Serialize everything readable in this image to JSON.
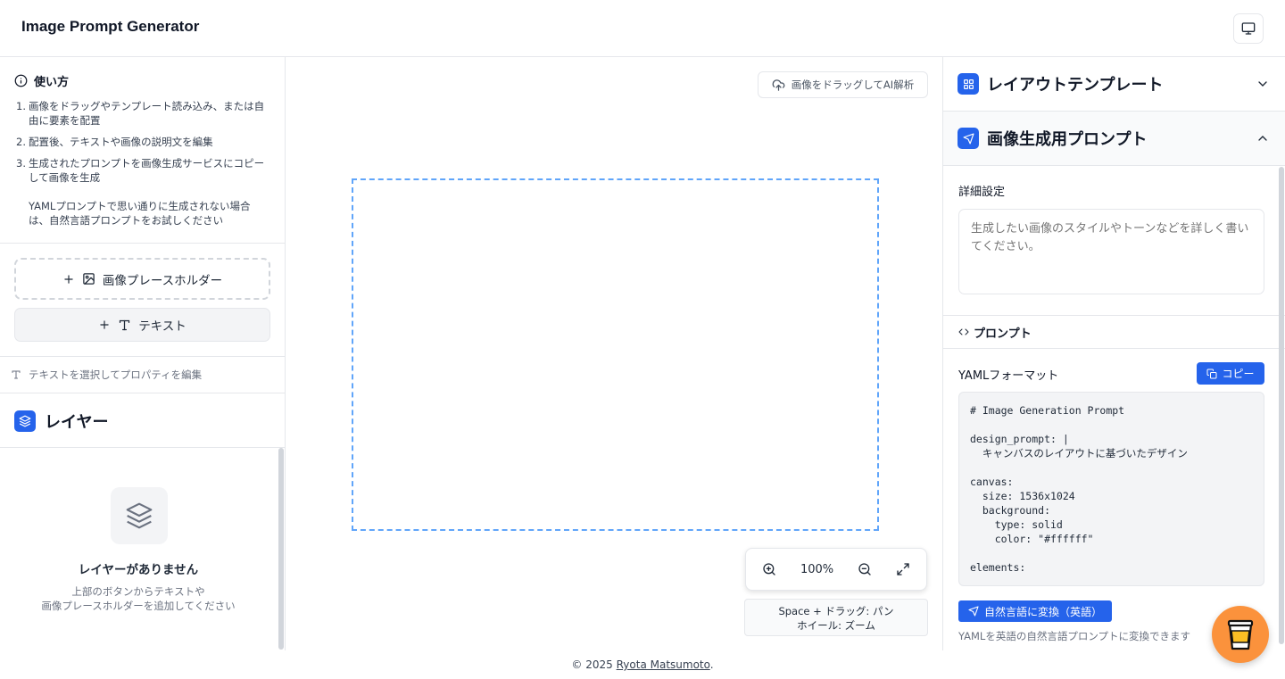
{
  "header": {
    "title": "Image Prompt Generator",
    "monitor_icon": "monitor-icon"
  },
  "howto": {
    "title": "使い方",
    "steps": [
      {
        "num": "1.",
        "text": "画像をドラッグやテンプレート読み込み、または自由に要素を配置"
      },
      {
        "num": "2.",
        "text": "配置後、テキストや画像の説明文を編集"
      },
      {
        "num": "3.",
        "text": "生成されたプロンプトを画像生成サービスにコピーして画像を生成"
      }
    ],
    "note": "YAMLプロンプトで思い通りに生成されない場合は、自然言語プロンプトをお試しください"
  },
  "tools": {
    "image_placeholder_label": "画像プレースホルダー",
    "text_label": "テキスト",
    "property_hint": "テキストを選択してプロパティを編集"
  },
  "layers": {
    "title": "レイヤー",
    "empty_title": "レイヤーがありません",
    "empty_desc_1": "上部のボタンからテキストや",
    "empty_desc_2": "画像プレースホルダーを追加してください"
  },
  "canvas": {
    "ai_button_label": "画像をドラッグしてAI解析",
    "zoom_level": "100%",
    "help_line_1": "Space + ドラッグ: パン",
    "help_line_2": "ホイール: ズーム"
  },
  "right": {
    "layout_template_title": "レイアウトテンプレート",
    "prompt_section_title": "画像生成用プロンプト",
    "detail_label": "詳細設定",
    "detail_placeholder": "生成したい画像のスタイルやトーンなどを詳しく書いてください。",
    "prompt_tab": "プロンプト",
    "yaml_label": "YAMLフォーマット",
    "copy_label": "コピー",
    "yaml_code": "# Image Generation Prompt\n\ndesign_prompt: |\n  キャンバスのレイアウトに基づいたデザイン\n\ncanvas:\n  size: 1536x1024\n  background:\n    type: solid\n    color: \"#ffffff\"\n\nelements:",
    "nl_button_label": "自然言語に変換（英語）",
    "nl_desc": "YAMLを英語の自然言語プロンプトに変換できます"
  },
  "footer": {
    "copyright": "© 2025",
    "author": "Ryota Matsumoto",
    "suffix": "."
  },
  "colors": {
    "accent": "#2563eb",
    "canvas_border": "#60a5fa",
    "coffee": "#fb923c"
  }
}
